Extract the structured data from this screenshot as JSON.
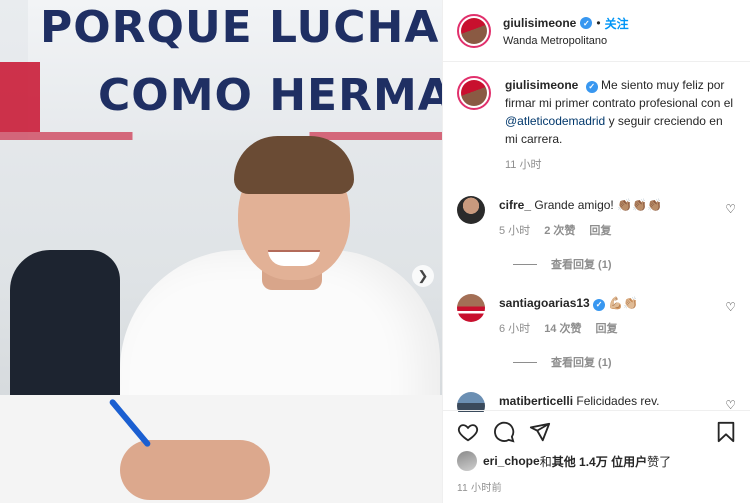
{
  "photo": {
    "slogan_line1": "PORQUE LUCHAN",
    "slogan_line2": "COMO HERMANOS",
    "next_arrow": "❯"
  },
  "header": {
    "username": "giulisimeone",
    "separator": "•",
    "follow_label": "关注",
    "location": "Wanda Metropolitano"
  },
  "caption": {
    "username": "giulisimeone",
    "text_before_mention": "Me siento muy feliz por firmar mi primer contrato profesional con el ",
    "mention": "@atleticodemadrid",
    "text_after_mention": " y seguir creciendo en mi carrera.",
    "time": "11 小时"
  },
  "comments": [
    {
      "username": "cifre_",
      "text": "Grande amigo! 👏🏽👏🏽👏🏽",
      "time": "5 小时",
      "likes": "2 次赞",
      "reply_label": "回复",
      "view_replies": "查看回复 (1)"
    },
    {
      "username": "santiagoarias13",
      "text": "💪🏼👏🏼",
      "time": "6 小时",
      "likes": "14 次赞",
      "reply_label": "回复",
      "view_replies": "查看回复 (1)"
    },
    {
      "username": "matiberticelli",
      "text": "Felicidades rev."
    }
  ],
  "actions": {
    "liked_by_user": "eri_chope",
    "liked_by_mid": " 和 ",
    "liked_by_others": "其他 1.4万 位用户",
    "liked_by_end": " 赞了",
    "timestamp": "11 小时前"
  },
  "colors": {
    "accent": "#0095f6",
    "verified": "#3897f0",
    "mention": "#00376b",
    "muted": "#8e8e8e"
  }
}
